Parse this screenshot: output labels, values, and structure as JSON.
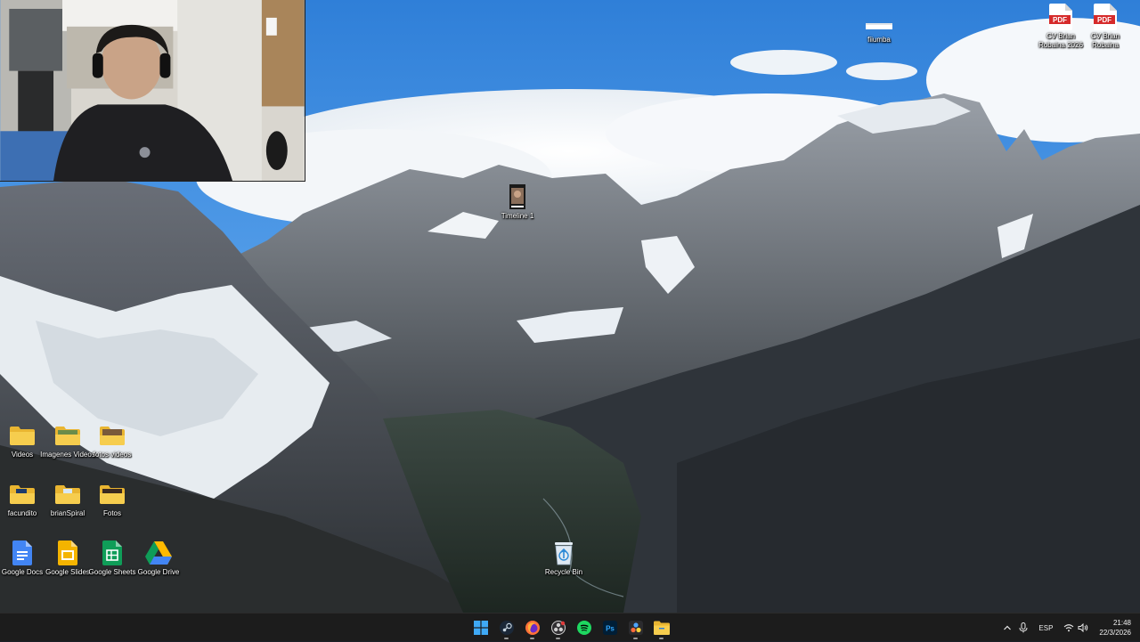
{
  "desktop": {
    "icons": {
      "videos": {
        "label": "Videos",
        "icon": "folder-icon"
      },
      "imagenes_videos": {
        "label": "Imagenes Videos",
        "icon": "folder-image-icon"
      },
      "fotos_videos": {
        "label": "fotos videos",
        "icon": "folder-image-icon"
      },
      "facundito": {
        "label": "facundito",
        "icon": "folder-icon"
      },
      "brianspiral": {
        "label": "brianSpiral",
        "icon": "folder-icon"
      },
      "fotos": {
        "label": "Fotos",
        "icon": "folder-image-icon"
      },
      "google_docs": {
        "label": "Google Docs",
        "icon": "google-docs-icon"
      },
      "google_slides": {
        "label": "Google Slides",
        "icon": "google-slides-icon"
      },
      "google_sheets": {
        "label": "Google Sheets",
        "icon": "google-sheets-icon"
      },
      "google_drive": {
        "label": "Google Drive",
        "icon": "google-drive-icon"
      },
      "recycle_bin": {
        "label": "Recycle Bin",
        "icon": "recycle-bin-icon"
      },
      "timeline": {
        "label": "Timeline 1",
        "icon": "video-file-icon"
      },
      "fiiumba": {
        "label": "fiiumba",
        "icon": "file-icon"
      },
      "cv_2026": {
        "label": "CV Brian Robaina 2026",
        "icon": "pdf-icon"
      },
      "cv": {
        "label": "CV Brian Robaina",
        "icon": "pdf-icon"
      }
    }
  },
  "taskbar": {
    "apps": [
      "start-icon",
      "steam-icon",
      "firefox-icon",
      "obs-icon",
      "spotify-icon",
      "photoshop-icon",
      "davinci-resolve-icon",
      "file-explorer-icon"
    ],
    "tray": {
      "language": "ESP",
      "time": "21:48",
      "date": "22/3/2026"
    }
  },
  "colors": {
    "taskbar_bg": "#1c1c1c",
    "folder_yellow": "#f4c542",
    "accent_blue": "#0a84ff"
  }
}
